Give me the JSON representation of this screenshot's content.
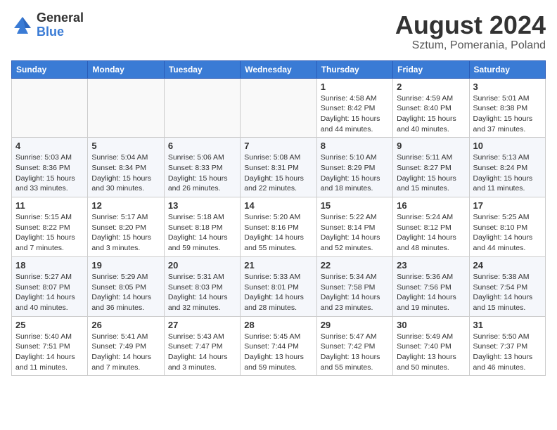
{
  "header": {
    "logo_general": "General",
    "logo_blue": "Blue",
    "main_title": "August 2024",
    "subtitle": "Sztum, Pomerania, Poland"
  },
  "days_of_week": [
    "Sunday",
    "Monday",
    "Tuesday",
    "Wednesday",
    "Thursday",
    "Friday",
    "Saturday"
  ],
  "weeks": [
    [
      {
        "day": "",
        "info": ""
      },
      {
        "day": "",
        "info": ""
      },
      {
        "day": "",
        "info": ""
      },
      {
        "day": "",
        "info": ""
      },
      {
        "day": "1",
        "info": "Sunrise: 4:58 AM\nSunset: 8:42 PM\nDaylight: 15 hours\nand 44 minutes."
      },
      {
        "day": "2",
        "info": "Sunrise: 4:59 AM\nSunset: 8:40 PM\nDaylight: 15 hours\nand 40 minutes."
      },
      {
        "day": "3",
        "info": "Sunrise: 5:01 AM\nSunset: 8:38 PM\nDaylight: 15 hours\nand 37 minutes."
      }
    ],
    [
      {
        "day": "4",
        "info": "Sunrise: 5:03 AM\nSunset: 8:36 PM\nDaylight: 15 hours\nand 33 minutes."
      },
      {
        "day": "5",
        "info": "Sunrise: 5:04 AM\nSunset: 8:34 PM\nDaylight: 15 hours\nand 30 minutes."
      },
      {
        "day": "6",
        "info": "Sunrise: 5:06 AM\nSunset: 8:33 PM\nDaylight: 15 hours\nand 26 minutes."
      },
      {
        "day": "7",
        "info": "Sunrise: 5:08 AM\nSunset: 8:31 PM\nDaylight: 15 hours\nand 22 minutes."
      },
      {
        "day": "8",
        "info": "Sunrise: 5:10 AM\nSunset: 8:29 PM\nDaylight: 15 hours\nand 18 minutes."
      },
      {
        "day": "9",
        "info": "Sunrise: 5:11 AM\nSunset: 8:27 PM\nDaylight: 15 hours\nand 15 minutes."
      },
      {
        "day": "10",
        "info": "Sunrise: 5:13 AM\nSunset: 8:24 PM\nDaylight: 15 hours\nand 11 minutes."
      }
    ],
    [
      {
        "day": "11",
        "info": "Sunrise: 5:15 AM\nSunset: 8:22 PM\nDaylight: 15 hours\nand 7 minutes."
      },
      {
        "day": "12",
        "info": "Sunrise: 5:17 AM\nSunset: 8:20 PM\nDaylight: 15 hours\nand 3 minutes."
      },
      {
        "day": "13",
        "info": "Sunrise: 5:18 AM\nSunset: 8:18 PM\nDaylight: 14 hours\nand 59 minutes."
      },
      {
        "day": "14",
        "info": "Sunrise: 5:20 AM\nSunset: 8:16 PM\nDaylight: 14 hours\nand 55 minutes."
      },
      {
        "day": "15",
        "info": "Sunrise: 5:22 AM\nSunset: 8:14 PM\nDaylight: 14 hours\nand 52 minutes."
      },
      {
        "day": "16",
        "info": "Sunrise: 5:24 AM\nSunset: 8:12 PM\nDaylight: 14 hours\nand 48 minutes."
      },
      {
        "day": "17",
        "info": "Sunrise: 5:25 AM\nSunset: 8:10 PM\nDaylight: 14 hours\nand 44 minutes."
      }
    ],
    [
      {
        "day": "18",
        "info": "Sunrise: 5:27 AM\nSunset: 8:07 PM\nDaylight: 14 hours\nand 40 minutes."
      },
      {
        "day": "19",
        "info": "Sunrise: 5:29 AM\nSunset: 8:05 PM\nDaylight: 14 hours\nand 36 minutes."
      },
      {
        "day": "20",
        "info": "Sunrise: 5:31 AM\nSunset: 8:03 PM\nDaylight: 14 hours\nand 32 minutes."
      },
      {
        "day": "21",
        "info": "Sunrise: 5:33 AM\nSunset: 8:01 PM\nDaylight: 14 hours\nand 28 minutes."
      },
      {
        "day": "22",
        "info": "Sunrise: 5:34 AM\nSunset: 7:58 PM\nDaylight: 14 hours\nand 23 minutes."
      },
      {
        "day": "23",
        "info": "Sunrise: 5:36 AM\nSunset: 7:56 PM\nDaylight: 14 hours\nand 19 minutes."
      },
      {
        "day": "24",
        "info": "Sunrise: 5:38 AM\nSunset: 7:54 PM\nDaylight: 14 hours\nand 15 minutes."
      }
    ],
    [
      {
        "day": "25",
        "info": "Sunrise: 5:40 AM\nSunset: 7:51 PM\nDaylight: 14 hours\nand 11 minutes."
      },
      {
        "day": "26",
        "info": "Sunrise: 5:41 AM\nSunset: 7:49 PM\nDaylight: 14 hours\nand 7 minutes."
      },
      {
        "day": "27",
        "info": "Sunrise: 5:43 AM\nSunset: 7:47 PM\nDaylight: 14 hours\nand 3 minutes."
      },
      {
        "day": "28",
        "info": "Sunrise: 5:45 AM\nSunset: 7:44 PM\nDaylight: 13 hours\nand 59 minutes."
      },
      {
        "day": "29",
        "info": "Sunrise: 5:47 AM\nSunset: 7:42 PM\nDaylight: 13 hours\nand 55 minutes."
      },
      {
        "day": "30",
        "info": "Sunrise: 5:49 AM\nSunset: 7:40 PM\nDaylight: 13 hours\nand 50 minutes."
      },
      {
        "day": "31",
        "info": "Sunrise: 5:50 AM\nSunset: 7:37 PM\nDaylight: 13 hours\nand 46 minutes."
      }
    ]
  ]
}
